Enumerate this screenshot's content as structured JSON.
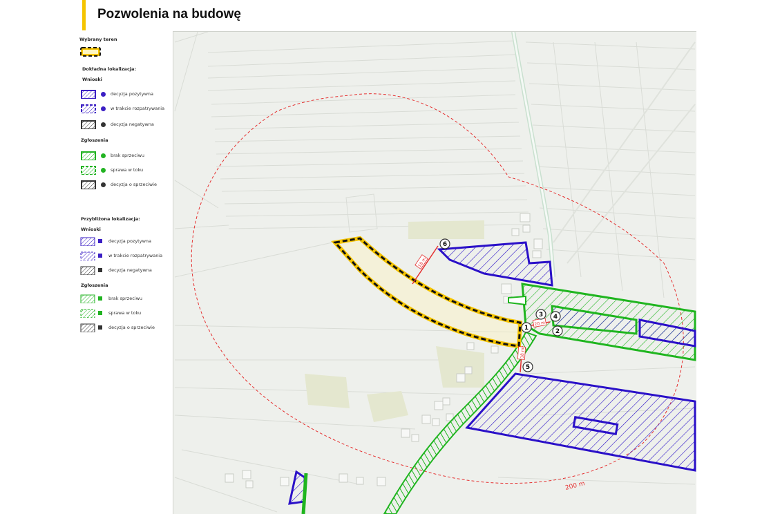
{
  "page": {
    "title": "Pozwolenia na budowę"
  },
  "legend": {
    "selected": {
      "heading": "Wybrany teren"
    },
    "exact": {
      "heading": "Dokładna lokalizacja:",
      "wnioski": {
        "heading": "Wnioski",
        "items": [
          {
            "label": "decyzja pozytywna",
            "color": "#3b1fc4"
          },
          {
            "label": "w trakcie rozpatrywania",
            "color": "#3b1fc4"
          },
          {
            "label": "decyzja negatywna",
            "color": "#333333"
          }
        ]
      },
      "zgloszenia": {
        "heading": "Zgłoszenia",
        "items": [
          {
            "label": "brak sprzeciwu",
            "color": "#22b322"
          },
          {
            "label": "sprawa w toku",
            "color": "#22b322"
          },
          {
            "label": "decyzja o sprzeciwie",
            "color": "#333333"
          }
        ]
      }
    },
    "approx": {
      "heading": "Przybliżona lokalizacja:",
      "wnioski": {
        "heading": "Wnioski",
        "items": [
          {
            "label": "decyzja pozytywna",
            "color": "#3b1fc4"
          },
          {
            "label": "w trakcie rozpatrywania",
            "color": "#3b1fc4"
          },
          {
            "label": "decyzja negatywna",
            "color": "#333333"
          }
        ]
      },
      "zgloszenia": {
        "heading": "Zgłoszenia",
        "items": [
          {
            "label": "brak sprzeciwu",
            "color": "#22b322"
          },
          {
            "label": "sprawa w toku",
            "color": "#22b322"
          },
          {
            "label": "decyzja o sprzeciwie",
            "color": "#333333"
          }
        ]
      }
    }
  },
  "map": {
    "markers": [
      "1",
      "2",
      "3",
      "4",
      "5",
      "6"
    ],
    "distances": {
      "d6": "18 m",
      "d2": "20 m",
      "d5": "18 m"
    },
    "radius_label": "200 m",
    "colors": {
      "selected_fill": "#f5c400",
      "positive": "#2a10c8",
      "no_objection": "#1fb51f",
      "radius": "#e53030",
      "background": "#eef0ec"
    }
  }
}
